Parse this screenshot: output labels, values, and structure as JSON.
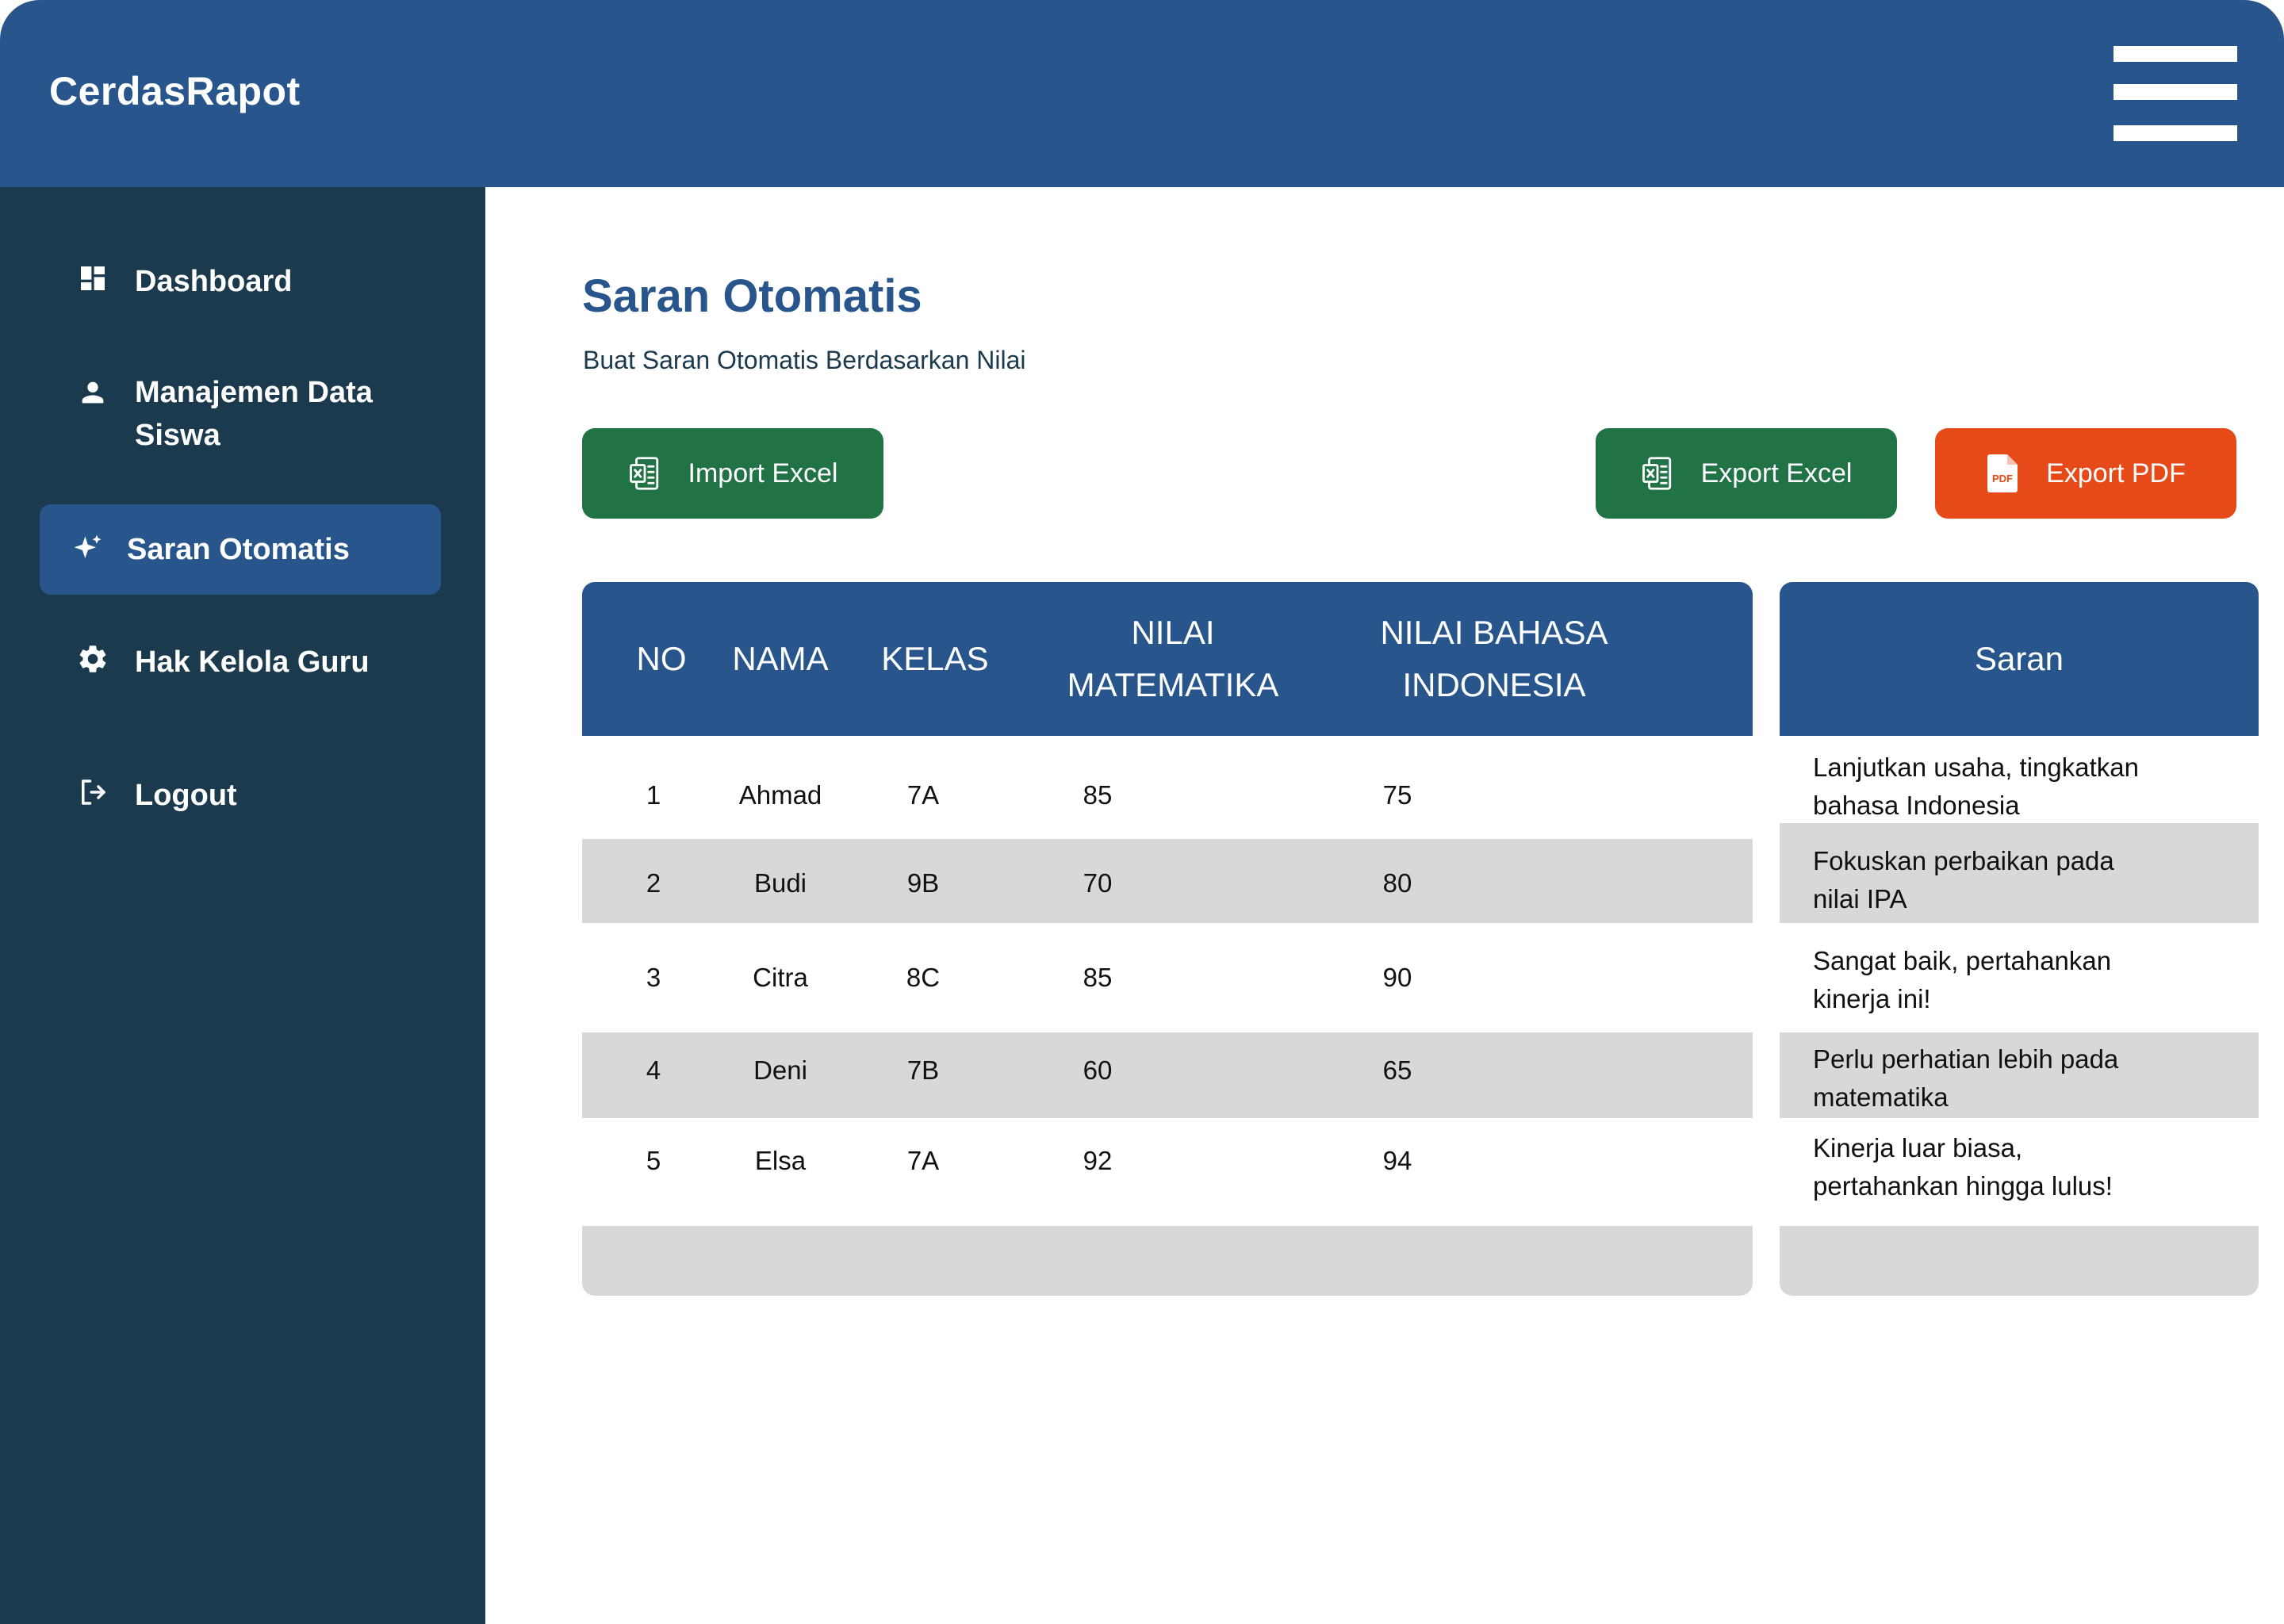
{
  "app": {
    "brand": "CerdasRapot"
  },
  "header": {
    "menu_icon": "hamburger-menu-icon"
  },
  "sidebar": {
    "items": [
      {
        "label": "Dashboard",
        "icon": "dashboard-icon",
        "active": false
      },
      {
        "label": "Manajemen Data",
        "label2": "Siswa",
        "icon": "user-icon",
        "active": false
      },
      {
        "label": "Saran Otomatis",
        "icon": "sparkle-icon",
        "active": true
      },
      {
        "label": "Hak Kelola Guru",
        "icon": "gear-icon",
        "active": false
      },
      {
        "label": "Logout",
        "icon": "logout-icon",
        "active": false
      }
    ]
  },
  "main": {
    "title": "Saran Otomatis",
    "subtitle": "Buat Saran Otomatis Berdasarkan Nilai",
    "buttons": {
      "import_excel": "Import Excel",
      "export_excel": "Export Excel",
      "export_pdf": "Export PDF",
      "pdf_badge": "PDF"
    }
  },
  "table": {
    "headers": {
      "no": "NO",
      "nama": "NAMA",
      "kelas": "KELAS",
      "mtk1": "NILAI",
      "mtk2": "MATEMATIKA",
      "bind1": "NILAI BAHASA",
      "bind2": "INDONESIA",
      "saran": "Saran"
    },
    "rows": [
      {
        "no": "1",
        "nama": "Ahmad",
        "kelas": "7A",
        "mtk": "85",
        "bind": "75",
        "saran1": "Lanjutkan usaha, tingkatkan",
        "saran2": "bahasa Indonesia"
      },
      {
        "no": "2",
        "nama": "Budi",
        "kelas": "9B",
        "mtk": "70",
        "bind": "80",
        "saran1": "Fokuskan perbaikan pada",
        "saran2": "nilai IPA"
      },
      {
        "no": "3",
        "nama": "Citra",
        "kelas": "8C",
        "mtk": "85",
        "bind": "90",
        "saran1": "Sangat baik, pertahankan",
        "saran2": "kinerja ini!"
      },
      {
        "no": "4",
        "nama": "Deni",
        "kelas": "7B",
        "mtk": "60",
        "bind": "65",
        "saran1": "Perlu perhatian lebih pada",
        "saran2": "matematika"
      },
      {
        "no": "5",
        "nama": "Elsa",
        "kelas": "7A",
        "mtk": "92",
        "bind": "94",
        "saran1": "Kinerja luar biasa,",
        "saran2": "pertahankan hingga lulus!"
      }
    ]
  },
  "colors": {
    "primary": "#28568c",
    "sidebar": "#1b3a4e",
    "excel_green": "#217346",
    "pdf_orange": "#e64a19",
    "row_gray": "#d8d8d8"
  }
}
